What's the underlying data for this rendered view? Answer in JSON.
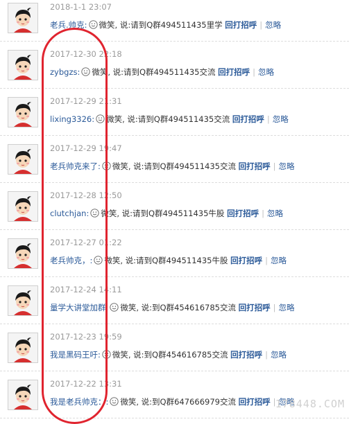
{
  "feed": {
    "items": [
      {
        "time": "2018-1-1 23:07",
        "user": "老兵.帅克:",
        "action": "微笑, 说:请到Q群494511435里学",
        "reply": "回打招呼",
        "sep": "|",
        "ignore": "忽略"
      },
      {
        "time": "2017-12-30 22:18",
        "user": "zybgzs:",
        "action": "微笑, 说:请到Q群494511435交流",
        "reply": "回打招呼",
        "sep": "|",
        "ignore": "忽略"
      },
      {
        "time": "2017-12-29 21:31",
        "user": "lixing3326:",
        "action": "微笑, 说:请到Q群494511435交流",
        "reply": "回打招呼",
        "sep": "|",
        "ignore": "忽略"
      },
      {
        "time": "2017-12-29 19:47",
        "user": "老兵帅克来了:",
        "action": "微笑, 说:请到Q群494511435交流",
        "reply": "回打招呼",
        "sep": "|",
        "ignore": "忽略"
      },
      {
        "time": "2017-12-28 12:50",
        "user": "clutchjan:",
        "action": "微笑, 说:请到Q群494511435牛股",
        "reply": "回打招呼",
        "sep": "|",
        "ignore": "忽略"
      },
      {
        "time": "2017-12-27 01:22",
        "user": "老兵帅克，:",
        "action": "微笑, 说:请到Q群494511435牛股",
        "reply": "回打招呼",
        "sep": "|",
        "ignore": "忽略"
      },
      {
        "time": "2017-12-24 14:11",
        "user": "量学大讲堂加群:",
        "action": "微笑, 说:到Q群454616785交流",
        "reply": "回打招呼",
        "sep": "|",
        "ignore": "忽略"
      },
      {
        "time": "2017-12-23 19:59",
        "user": "我是黑码王吁:",
        "action": "微笑, 说:到Q群454616785交流",
        "reply": "回打招呼",
        "sep": "|",
        "ignore": "忽略"
      },
      {
        "time": "2017-12-22 13:31",
        "user": "我是老兵帅克：:",
        "action": "微笑, 说:到Q群647666979交流",
        "reply": "回打招呼",
        "sep": "|",
        "ignore": "忽略"
      }
    ]
  },
  "watermark": "178448.COM"
}
